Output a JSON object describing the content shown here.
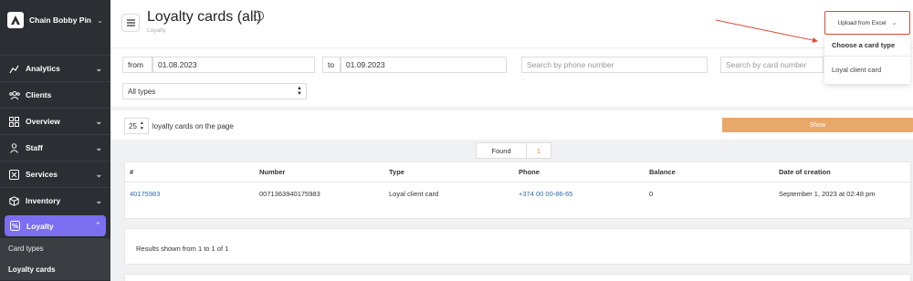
{
  "sidebar": {
    "brand": "Chain Bobby Pin",
    "items": [
      {
        "label": "Analytics",
        "icon": "chart-icon",
        "has_chevron": true
      },
      {
        "label": "Clients",
        "icon": "users-icon",
        "has_chevron": false
      },
      {
        "label": "Overview",
        "icon": "grid-icon",
        "has_chevron": true
      },
      {
        "label": "Staff",
        "icon": "person-icon",
        "has_chevron": true
      },
      {
        "label": "Services",
        "icon": "services-icon",
        "has_chevron": true
      },
      {
        "label": "Inventory",
        "icon": "box-icon",
        "has_chevron": true
      },
      {
        "label": "Loyalty",
        "icon": "loyalty-icon",
        "has_chevron": true,
        "active": true
      }
    ],
    "sub_items": [
      {
        "label": "Card types"
      },
      {
        "label": "Loyalty cards"
      }
    ]
  },
  "header": {
    "title": "Loyalty cards (all)",
    "breadcrumb": "Loyalty",
    "upload_button": "Upload from Excel",
    "dropdown": {
      "heading": "Choose a card type",
      "items": [
        "Loyal client card"
      ]
    }
  },
  "filters": {
    "from_label": "from",
    "from_value": "01.08.2023",
    "to_label": "to",
    "to_value": "01.09.2023",
    "phone_placeholder": "Search by phone number",
    "card_placeholder": "Search by card number",
    "type_select": "All types"
  },
  "pagination": {
    "per_page": "25",
    "per_page_label": "loyalty cards on the page",
    "show_button": "Show"
  },
  "found": {
    "label": "Found",
    "count": "1"
  },
  "table": {
    "headers": [
      "#",
      "Number",
      "Type",
      "Phone",
      "Balance",
      "Date of creation"
    ],
    "rows": [
      [
        "40175983",
        "0071363940175983",
        "Loyal client card",
        "+374 00 00-86-65",
        "0",
        "September 1, 2023 at 02:48 pm"
      ]
    ]
  },
  "results_text": "Results shown from 1 to 1 of 1",
  "colors": {
    "sidebar_bg": "#2b2e33",
    "active_item": "#7b6ef0",
    "accent_orange": "#e8a86a",
    "highlight_red": "#e04a3a",
    "link_blue": "#2e6db4"
  }
}
